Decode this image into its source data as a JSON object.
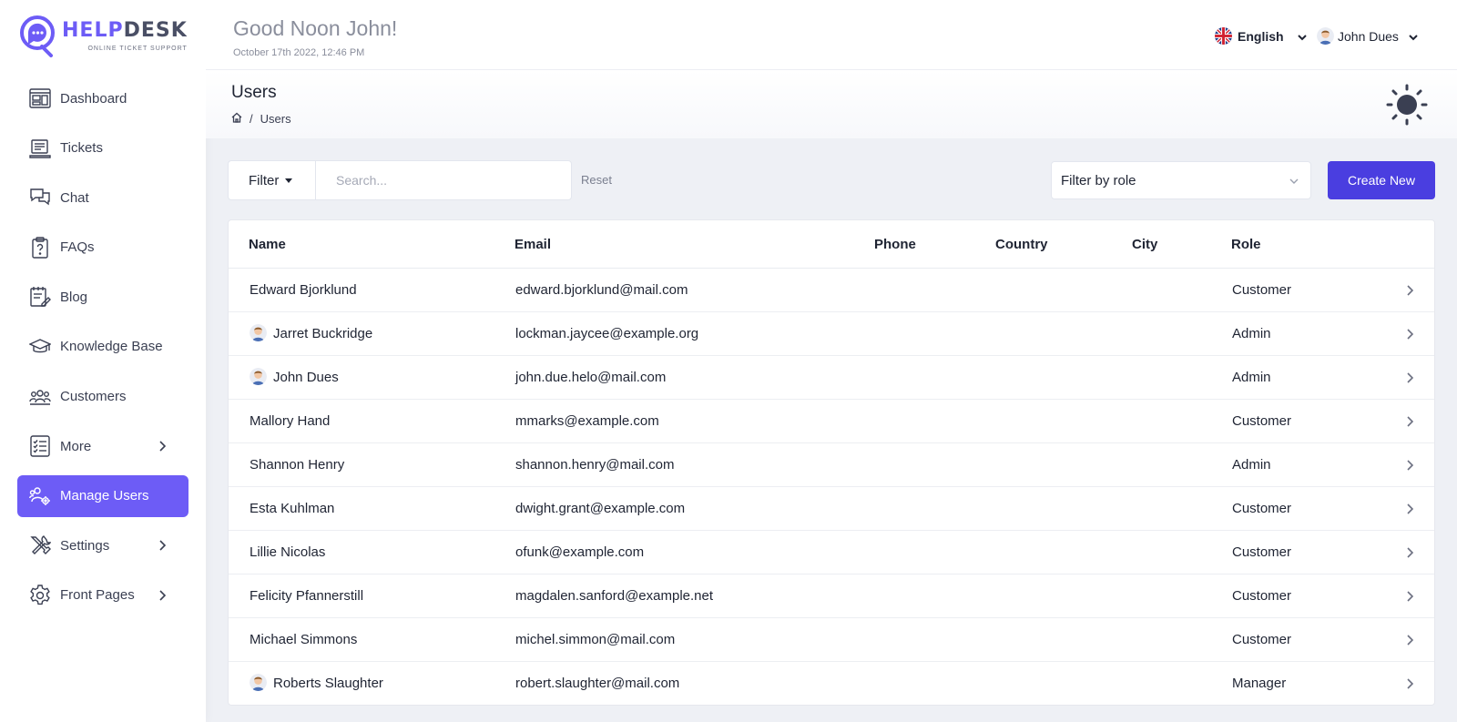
{
  "app": {
    "logo_part1": "HELP",
    "logo_part2": "DESK",
    "logo_tagline": "ONLINE TICKET SUPPORT"
  },
  "header": {
    "greeting": "Good Noon John!",
    "datetime": "October 17th 2022, 12:46 PM",
    "language": "English",
    "user_name": "John Dues"
  },
  "sidebar": {
    "items": [
      {
        "label": "Dashboard",
        "icon": "dashboard-icon"
      },
      {
        "label": "Tickets",
        "icon": "tickets-icon"
      },
      {
        "label": "Chat",
        "icon": "chat-icon"
      },
      {
        "label": "FAQs",
        "icon": "faq-icon"
      },
      {
        "label": "Blog",
        "icon": "blog-icon"
      },
      {
        "label": "Knowledge Base",
        "icon": "graduation-cap-icon"
      },
      {
        "label": "Customers",
        "icon": "customers-icon"
      },
      {
        "label": "More",
        "icon": "list-icon"
      },
      {
        "label": "Manage Users",
        "icon": "manage-users-icon"
      },
      {
        "label": "Settings",
        "icon": "tools-icon"
      },
      {
        "label": "Front Pages",
        "icon": "gear-icon"
      }
    ],
    "active": "Manage Users"
  },
  "page": {
    "title": "Users",
    "breadcrumb": "Users"
  },
  "toolbar": {
    "filter_label": "Filter",
    "search_placeholder": "Search...",
    "reset_label": "Reset",
    "role_filter_value": "Filter by role",
    "create_label": "Create New"
  },
  "table": {
    "columns": {
      "name": "Name",
      "email": "Email",
      "phone": "Phone",
      "country": "Country",
      "city": "City",
      "role": "Role"
    },
    "rows": [
      {
        "name": "Edward Bjorklund",
        "email": "edward.bjorklund@mail.com",
        "role": "Customer",
        "avatar": false
      },
      {
        "name": "Jarret Buckridge",
        "email": "lockman.jaycee@example.org",
        "role": "Admin",
        "avatar": true
      },
      {
        "name": "John Dues",
        "email": "john.due.helo@mail.com",
        "role": "Admin",
        "avatar": true
      },
      {
        "name": "Mallory Hand",
        "email": "mmarks@example.com",
        "role": "Customer",
        "avatar": false
      },
      {
        "name": "Shannon Henry",
        "email": "shannon.henry@mail.com",
        "role": "Admin",
        "avatar": false
      },
      {
        "name": "Esta Kuhlman",
        "email": "dwight.grant@example.com",
        "role": "Customer",
        "avatar": false
      },
      {
        "name": "Lillie Nicolas",
        "email": "ofunk@example.com",
        "role": "Customer",
        "avatar": false
      },
      {
        "name": "Felicity Pfannerstill",
        "email": "magdalen.sanford@example.net",
        "role": "Customer",
        "avatar": false
      },
      {
        "name": "Michael Simmons",
        "email": "michel.simmon@mail.com",
        "role": "Customer",
        "avatar": false
      },
      {
        "name": "Roberts Slaughter",
        "email": "robert.slaughter@mail.com",
        "role": "Manager",
        "avatar": true
      }
    ]
  },
  "colors": {
    "accent": "#6d5cf6",
    "button": "#4a3ee0"
  }
}
